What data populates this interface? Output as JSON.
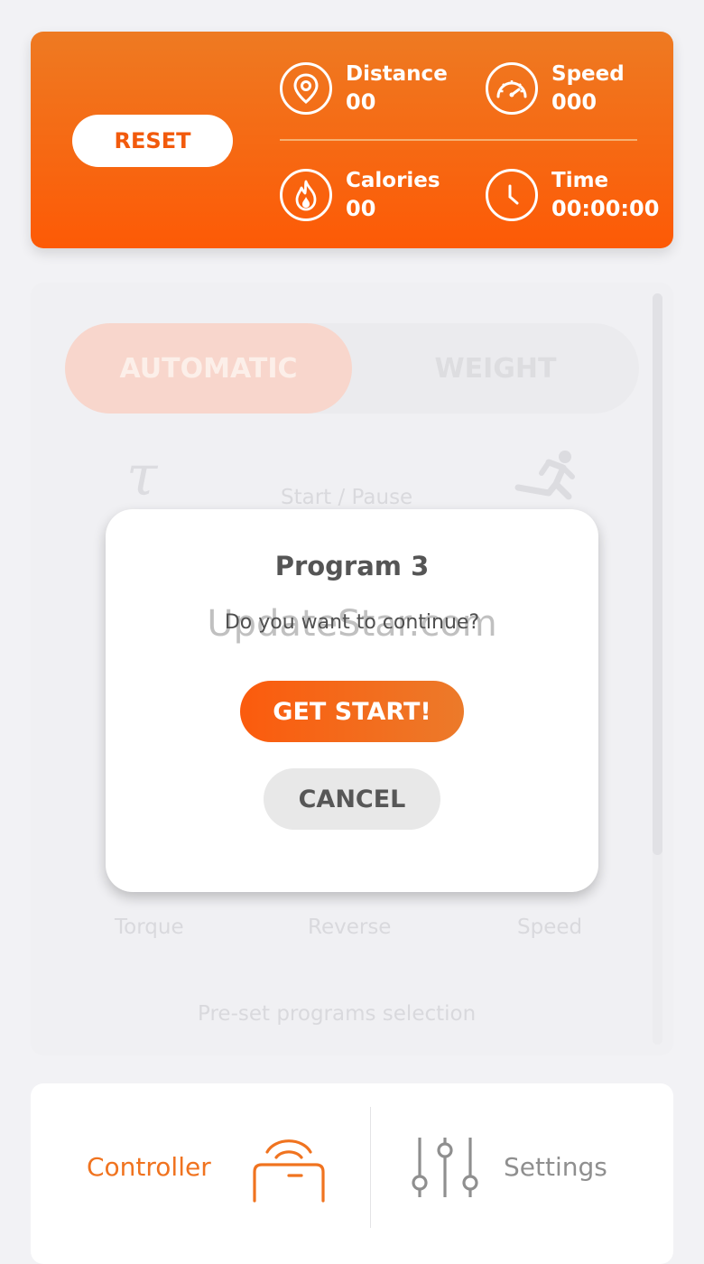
{
  "stats": {
    "reset_label": "RESET",
    "distance": {
      "label": "Distance",
      "value": "00"
    },
    "speed": {
      "label": "Speed",
      "value": "000"
    },
    "calories": {
      "label": "Calories",
      "value": "00"
    },
    "time": {
      "label": "Time",
      "value": "00:00:00"
    }
  },
  "mode": {
    "automatic_label": "AUTOMATIC",
    "weight_label": "WEIGHT"
  },
  "controls": {
    "start_pause": "Start / Pause",
    "torque": "Torque",
    "reverse": "Reverse",
    "speed": "Speed",
    "preset": "Pre-set programs selection"
  },
  "modal": {
    "title": "Program 3",
    "message": "Do you want to continue?",
    "confirm_label": "GET START!",
    "cancel_label": "CANCEL",
    "watermark": "UpdateStar.com"
  },
  "nav": {
    "controller_label": "Controller",
    "settings_label": "Settings"
  },
  "colors": {
    "accent": "#fd5a06",
    "accent_light": "#ee7a22",
    "active_nav": "#f0731f"
  }
}
